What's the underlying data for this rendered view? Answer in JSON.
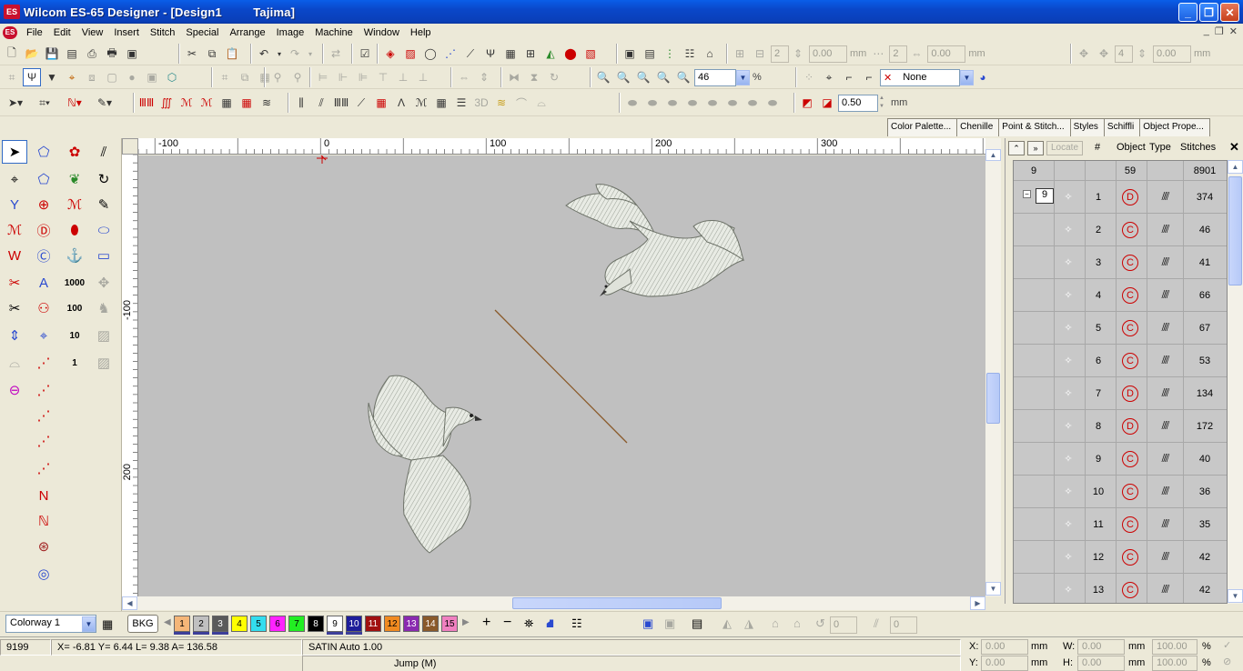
{
  "window": {
    "title": "Wilcom ES-65 Designer - [Design1         Tajima]",
    "app_logo": "ES"
  },
  "menu": {
    "doc_logo": "ES",
    "items": [
      "File",
      "Edit",
      "View",
      "Insert",
      "Stitch",
      "Special",
      "Arrange",
      "Image",
      "Machine",
      "Window",
      "Help"
    ]
  },
  "toolbar": {
    "zoom_value": "46",
    "zoom_unit": "%",
    "color_select": "None",
    "spacing_value": "0.50",
    "spacing_unit": "mm",
    "disabled_fields": {
      "count_a": "2",
      "val_a": "0.00",
      "unit_a": "mm",
      "count_b": "2",
      "val_b": "0.00",
      "unit_b": "mm",
      "count_c": "4",
      "val_c": "0.00",
      "unit_c": "mm"
    }
  },
  "docker_tabs": [
    "Color Palette...",
    "Chenille",
    "Point & Stitch...",
    "Styles",
    "Schiffli",
    "Object Prope..."
  ],
  "rulers": {
    "h_labels": [
      "-100",
      "0",
      "100",
      "200",
      "300"
    ],
    "v_labels": [
      "-100",
      "200"
    ]
  },
  "object_list": {
    "locate_label": "Locate",
    "columns": [
      "#",
      "Object",
      "Type",
      "Stitches"
    ],
    "summary": {
      "count": "9",
      "objects": "59",
      "stitches": "8901"
    },
    "group_num": "9",
    "rows": [
      {
        "n": "1",
        "stitches": "374",
        "type": "D"
      },
      {
        "n": "2",
        "stitches": "46",
        "type": "C"
      },
      {
        "n": "3",
        "stitches": "41",
        "type": "C"
      },
      {
        "n": "4",
        "stitches": "66",
        "type": "C"
      },
      {
        "n": "5",
        "stitches": "67",
        "type": "C"
      },
      {
        "n": "6",
        "stitches": "53",
        "type": "C"
      },
      {
        "n": "7",
        "stitches": "134",
        "type": "D"
      },
      {
        "n": "8",
        "stitches": "172",
        "type": "D"
      },
      {
        "n": "9",
        "stitches": "40",
        "type": "C"
      },
      {
        "n": "10",
        "stitches": "36",
        "type": "C"
      },
      {
        "n": "11",
        "stitches": "35",
        "type": "C"
      },
      {
        "n": "12",
        "stitches": "42",
        "type": "C"
      },
      {
        "n": "13",
        "stitches": "42",
        "type": "C"
      }
    ]
  },
  "colorbar": {
    "colorway": "Colorway 1",
    "bkg_label": "BKG",
    "swatches": [
      {
        "n": "1",
        "color": "#f5b678"
      },
      {
        "n": "2",
        "color": "#c0c0c0"
      },
      {
        "n": "3",
        "color": "#5a5a5a"
      },
      {
        "n": "4",
        "color": "#ffff00"
      },
      {
        "n": "5",
        "color": "#33ddee"
      },
      {
        "n": "6",
        "color": "#ff22ff"
      },
      {
        "n": "7",
        "color": "#22ee22"
      },
      {
        "n": "8",
        "color": "#000000"
      },
      {
        "n": "9",
        "color": "#ffffff"
      },
      {
        "n": "10",
        "color": "#1e1e9a"
      },
      {
        "n": "11",
        "color": "#a01010"
      },
      {
        "n": "12",
        "color": "#f08a20"
      },
      {
        "n": "13",
        "color": "#8a2ab0"
      },
      {
        "n": "14",
        "color": "#8a5a2a"
      },
      {
        "n": "15",
        "color": "#f080c0"
      }
    ]
  },
  "status": {
    "stitch_count": "9199",
    "coords": "X= -6.81 Y=  6.44 L=   9.38 A= 136.58",
    "stitch_type": "SATIN Auto  1.00",
    "jump": "Jump (M)",
    "x_label": "X:",
    "x_val": "0.00",
    "y_label": "Y:",
    "y_val": "0.00",
    "w_label": "W:",
    "w_val": "0.00",
    "w_pct": "100.00",
    "h_label": "H:",
    "h_val": "0.00",
    "h_pct": "100.00",
    "mm": "mm",
    "pct": "%"
  }
}
